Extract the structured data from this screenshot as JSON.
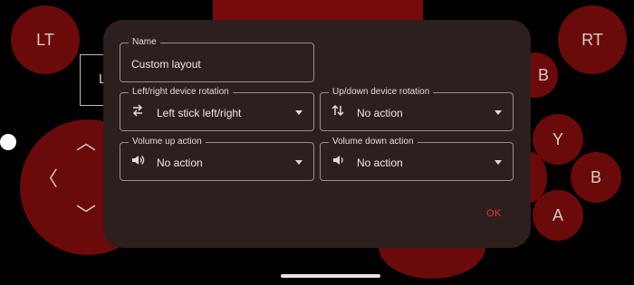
{
  "gamepad": {
    "lt_label": "LT",
    "rt_label": "RT",
    "y_label": "Y",
    "b_label": "B",
    "a_label": "A",
    "l_partial": "L",
    "b_partial": "B"
  },
  "dialog": {
    "name": {
      "label": "Name",
      "value": "Custom layout"
    },
    "lr_rotation": {
      "label": "Left/right device rotation",
      "value": "Left stick left/right",
      "icon": "swap-horiz-icon"
    },
    "ud_rotation": {
      "label": "Up/down device rotation",
      "value": "No action",
      "icon": "swap-vert-icon"
    },
    "vol_up": {
      "label": "Volume up action",
      "value": "No action",
      "icon": "volume-up-icon"
    },
    "vol_down": {
      "label": "Volume down action",
      "value": "No action",
      "icon": "volume-down-icon"
    },
    "ok_label": "OK"
  },
  "colors": {
    "dialog_bg": "#2d1f1e",
    "accent": "#e6392f",
    "button_red": "#6b0a0a"
  }
}
